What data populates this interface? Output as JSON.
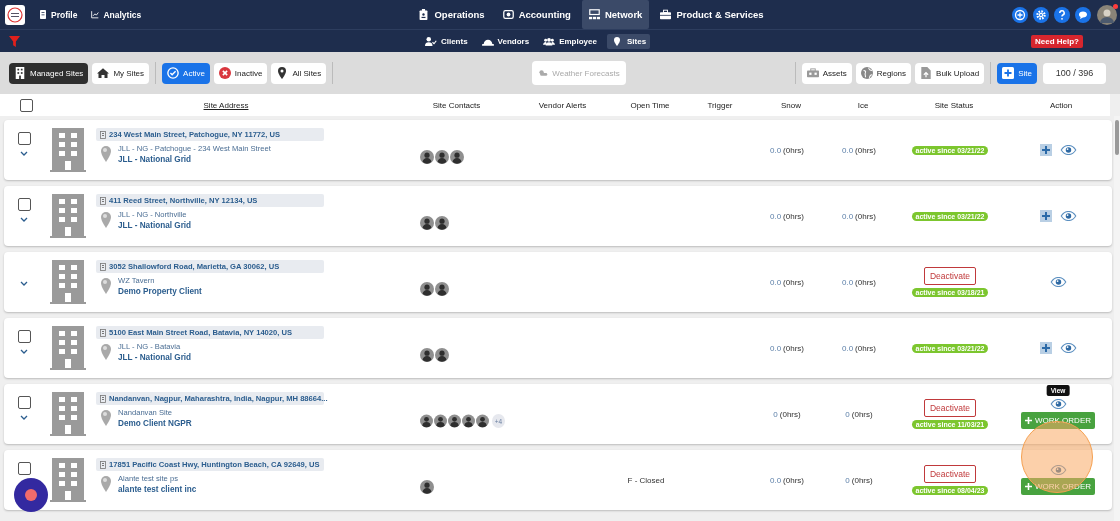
{
  "top_nav": {
    "left_links": [
      {
        "label": "Profile",
        "kind": "profile"
      },
      {
        "label": "Analytics",
        "kind": "analytics"
      }
    ],
    "tabs": [
      {
        "label": "Operations",
        "kind": "clipboard",
        "selected": false
      },
      {
        "label": "Accounting",
        "kind": "money",
        "selected": false
      },
      {
        "label": "Network",
        "kind": "network",
        "selected": true
      },
      {
        "label": "Product & Services",
        "kind": "briefcase",
        "selected": false
      }
    ],
    "icon_buttons": [
      {
        "kind": "plus-circle"
      },
      {
        "kind": "settings"
      },
      {
        "kind": "help"
      },
      {
        "kind": "chat"
      }
    ],
    "notification_dot": true
  },
  "sub_nav": {
    "tabs": [
      {
        "label": "Clients",
        "kind": "user-check",
        "selected": false
      },
      {
        "label": "Vendors",
        "kind": "hardhat",
        "selected": false
      },
      {
        "label": "Employee",
        "kind": "users",
        "selected": false
      },
      {
        "label": "Sites",
        "kind": "pin",
        "selected": true
      }
    ],
    "help_button": "Need Help?"
  },
  "toolbar": {
    "scope": [
      {
        "label": "Managed Sites",
        "kind": "building",
        "selected": true
      },
      {
        "label": "My Sites",
        "kind": "home",
        "selected": false
      }
    ],
    "status_filters": [
      {
        "label": "Active",
        "kind": "check",
        "selected": true
      },
      {
        "label": "Inactive",
        "kind": "cross",
        "selected": false
      },
      {
        "label": "All Sites",
        "kind": "pin",
        "selected": false
      }
    ],
    "weather_button": {
      "label": "Weather Forecasts",
      "disabled": true
    },
    "actions": [
      {
        "label": "Assets",
        "kind": "assets"
      },
      {
        "label": "Regions",
        "kind": "globe"
      },
      {
        "label": "Bulk Upload",
        "kind": "upload"
      }
    ],
    "add_button": "Site",
    "counter": "100 / 396"
  },
  "table": {
    "select_all": {
      "checked": false
    },
    "columns": [
      "Site Address",
      "Site Contacts",
      "Vendor Alerts",
      "Open Time",
      "Trigger",
      "Snow",
      "Ice",
      "Site Status",
      "Action"
    ],
    "rows": [
      {
        "checkbox": {
          "checked": false
        },
        "address": "234 West Main Street, Patchogue, NY 11772, US",
        "site": "JLL - NG - Patchogue - 234 West Main Street",
        "client": "JLL - National Grid",
        "contacts": [
          {
            "kind": "person"
          },
          {
            "kind": "person"
          },
          {
            "kind": "person"
          }
        ],
        "snow": {
          "value": "0.0",
          "hrs": "(0hrs)"
        },
        "ice": {
          "value": "0.0",
          "hrs": "(0hrs)"
        },
        "status": "active since 03/21/22",
        "add": true
      },
      {
        "checkbox": {
          "checked": false
        },
        "address": "411 Reed Street, Northville, NY 12134, US",
        "site": "JLL - NG - Northville",
        "client": "JLL - National Grid",
        "contacts": [
          {
            "kind": "person"
          },
          {
            "kind": "person"
          }
        ],
        "snow": {
          "value": "0.0",
          "hrs": "(0hrs)"
        },
        "ice": {
          "value": "0.0",
          "hrs": "(0hrs)"
        },
        "status": "active since 03/21/22",
        "add": true
      },
      {
        "address": "3052 Shallowford Road, Marietta, GA 30062, US",
        "site": "WZ Tavern",
        "client": "Demo Property Client",
        "contacts": [
          {
            "kind": "person"
          },
          {
            "kind": "person"
          }
        ],
        "snow": {
          "value": "0.0",
          "hrs": "(0hrs)"
        },
        "ice": {
          "value": "0.0",
          "hrs": "(0hrs)"
        },
        "deactivate": "Deactivate",
        "status": "active since 03/18/21"
      },
      {
        "checkbox": {
          "checked": false
        },
        "address": "5100 East Main Street Road, Batavia, NY 14020, US",
        "site": "JLL - NG - Batavia",
        "client": "JLL - National Grid",
        "contacts": [
          {
            "kind": "person"
          },
          {
            "kind": "person"
          }
        ],
        "snow": {
          "value": "0.0",
          "hrs": "(0hrs)"
        },
        "ice": {
          "value": "0.0",
          "hrs": "(0hrs)"
        },
        "status": "active since 03/21/22",
        "add": true
      },
      {
        "checkbox": {
          "checked": false
        },
        "address": "Nandanvan, Nagpur, Maharashtra, India, Nagpur, MH 88664...",
        "site": "Nandanvan Site",
        "client": "Demo Client NGPR",
        "contacts": [
          {
            "kind": "person"
          },
          {
            "kind": "person"
          },
          {
            "kind": "person"
          },
          {
            "kind": "person"
          },
          {
            "kind": "person"
          }
        ],
        "more_contacts": "+4",
        "snow": {
          "value": "0",
          "hrs": "(0hrs)"
        },
        "ice": {
          "value": "0",
          "hrs": "(0hrs)"
        },
        "deactivate": "Deactivate",
        "status": "active since 11/03/21",
        "tooltip": "View",
        "work_order": "WORK ORDER"
      },
      {
        "checkbox": {
          "checked": false
        },
        "address": "17851 Pacific Coast Hwy, Huntington Beach, CA 92649, US",
        "site": "Alante test site ps",
        "client": "alante test client inc",
        "contacts": [
          {
            "kind": "person"
          }
        ],
        "open_time": "F - Closed",
        "snow": {
          "value": "0.0",
          "hrs": "(0hrs)"
        },
        "ice": {
          "value": "0",
          "hrs": "(0hrs)"
        },
        "deactivate": "Deactivate",
        "status": "active since 08/04/23",
        "work_order": "WORK ORDER"
      }
    ]
  }
}
